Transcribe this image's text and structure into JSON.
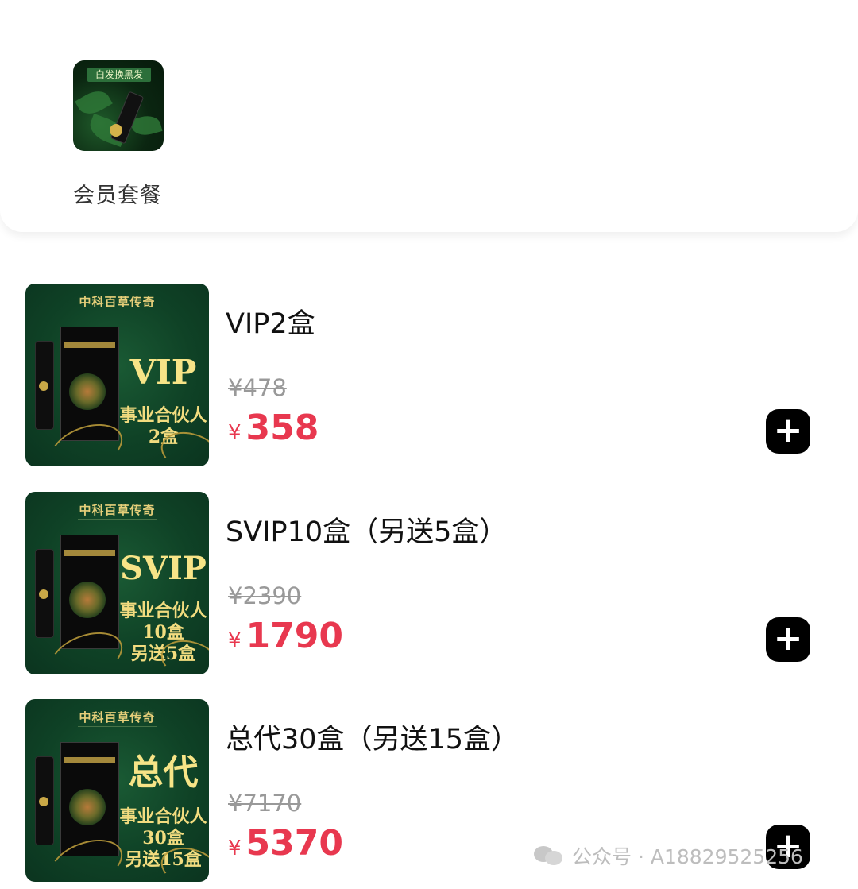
{
  "category": {
    "thumb_title": "白发换黑发",
    "label": "会员套餐"
  },
  "products": [
    {
      "title": "VIP2盒",
      "brand": "中科百草传奇",
      "tag_big": "VIP",
      "tag_lines": "事业合伙人\n2盒",
      "original_price": "¥478",
      "currency": "¥",
      "price": "358"
    },
    {
      "title": "SVIP10盒（另送5盒）",
      "brand": "中科百草传奇",
      "tag_big": "SVIP",
      "tag_lines": "事业合伙人\n10盒\n另送5盒",
      "original_price": "¥2390",
      "currency": "¥",
      "price": "1790"
    },
    {
      "title": "总代30盒（另送15盒）",
      "brand": "中科百草传奇",
      "tag_big": "总代",
      "tag_lines": "事业合伙人\n30盒\n另送15盒",
      "original_price": "¥7170",
      "currency": "¥",
      "price": "5370"
    }
  ],
  "add_icon": "plus-icon",
  "watermark": {
    "icon": "wechat-icon",
    "text": "公众号 · A18829525256"
  },
  "colors": {
    "price": "#e8384f",
    "product_bg": "#0f4226",
    "gold": "#f2dc7f"
  }
}
